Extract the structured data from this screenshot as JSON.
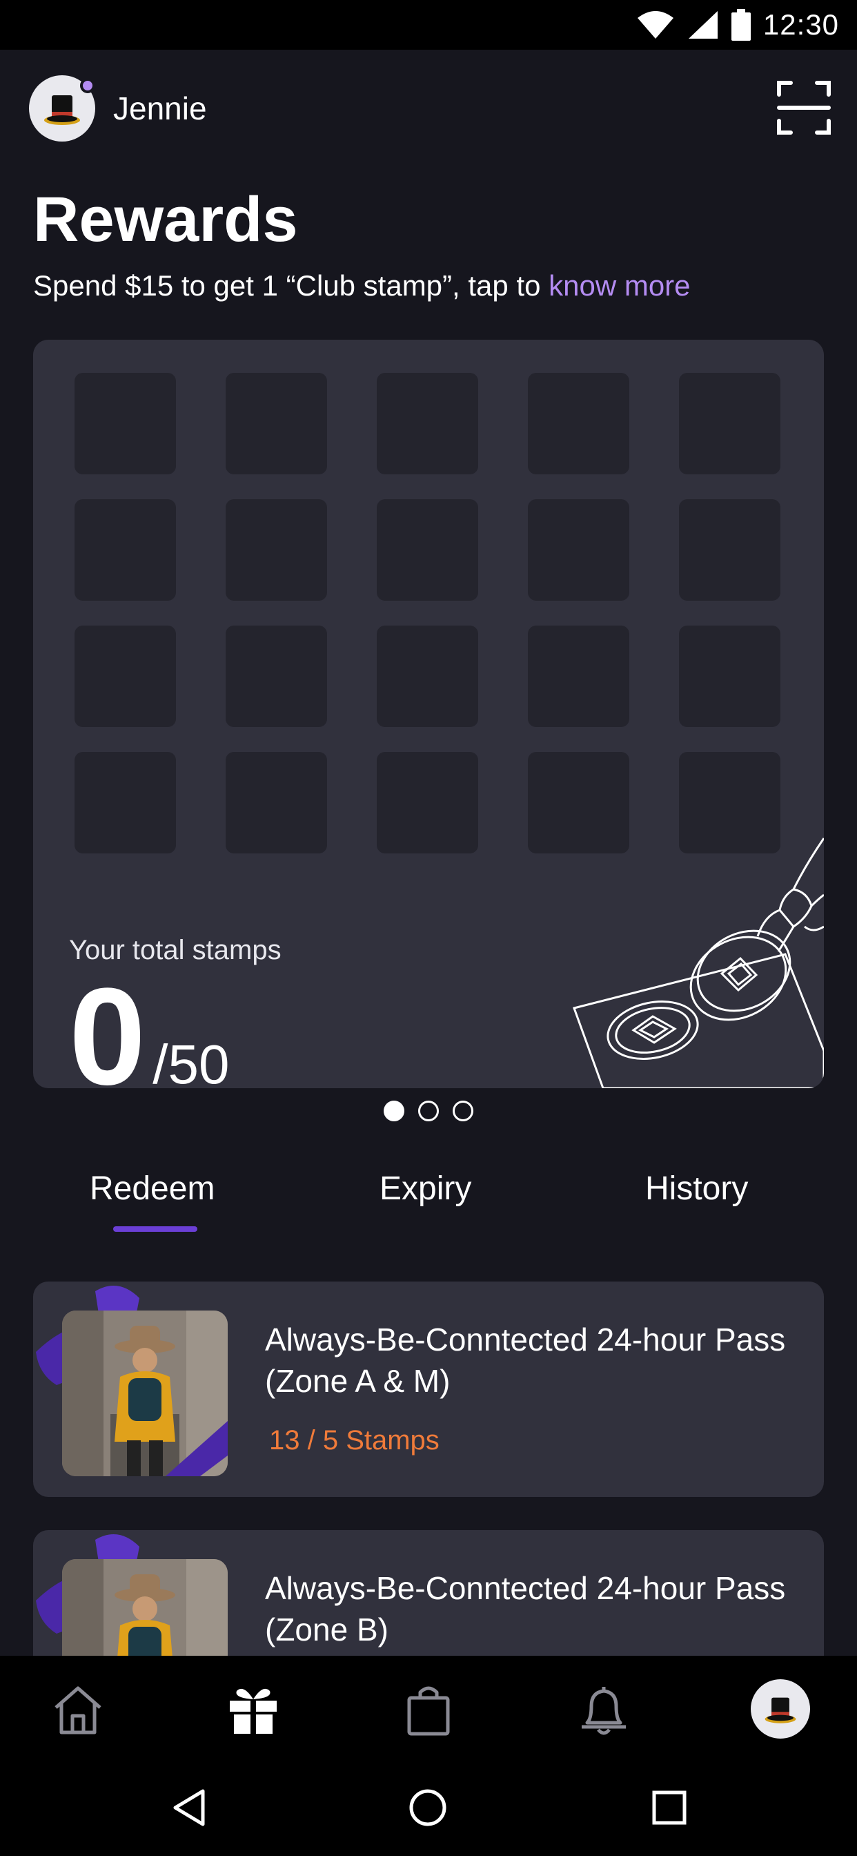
{
  "status_bar": {
    "time": "12:30",
    "icons": [
      "wifi-icon",
      "signal-icon",
      "battery-icon"
    ]
  },
  "header": {
    "username": "Jennie",
    "avatar_icon": "top-hat-icon",
    "scan_icon": "scan-frame-icon"
  },
  "page": {
    "title": "Rewards",
    "subtitle_prefix": "Spend $15 to get 1 “Club stamp”, tap to ",
    "subtitle_link": "know more"
  },
  "stamps": {
    "total_label": "Your total stamps",
    "collected": "0",
    "max": "/50",
    "slots_visible": 20,
    "pager": {
      "pages": 3,
      "active": 0
    }
  },
  "tabs": [
    {
      "label": "Redeem",
      "active": true
    },
    {
      "label": "Expiry",
      "active": false
    },
    {
      "label": "History",
      "active": false
    }
  ],
  "rewards": [
    {
      "title": "Always-Be-Conntected 24-hour Pass  (Zone A & M)",
      "stamps": "13 / 5 Stamps"
    },
    {
      "title": "Always-Be-Conntected 24-hour Pass  (Zone B)",
      "stamps": ""
    }
  ],
  "bottom_nav": [
    {
      "icon": "home-icon",
      "active": false
    },
    {
      "icon": "gift-icon",
      "active": true
    },
    {
      "icon": "shopping-bag-icon",
      "active": false
    },
    {
      "icon": "bell-icon",
      "active": false
    },
    {
      "icon": "profile-avatar-icon",
      "active": false
    }
  ],
  "colors": {
    "background": "#16161e",
    "card": "#31313d",
    "slot": "#24242d",
    "accent": "#b48cf2",
    "indicator": "#6b3fd6",
    "stamps_text": "#f07b3a"
  }
}
